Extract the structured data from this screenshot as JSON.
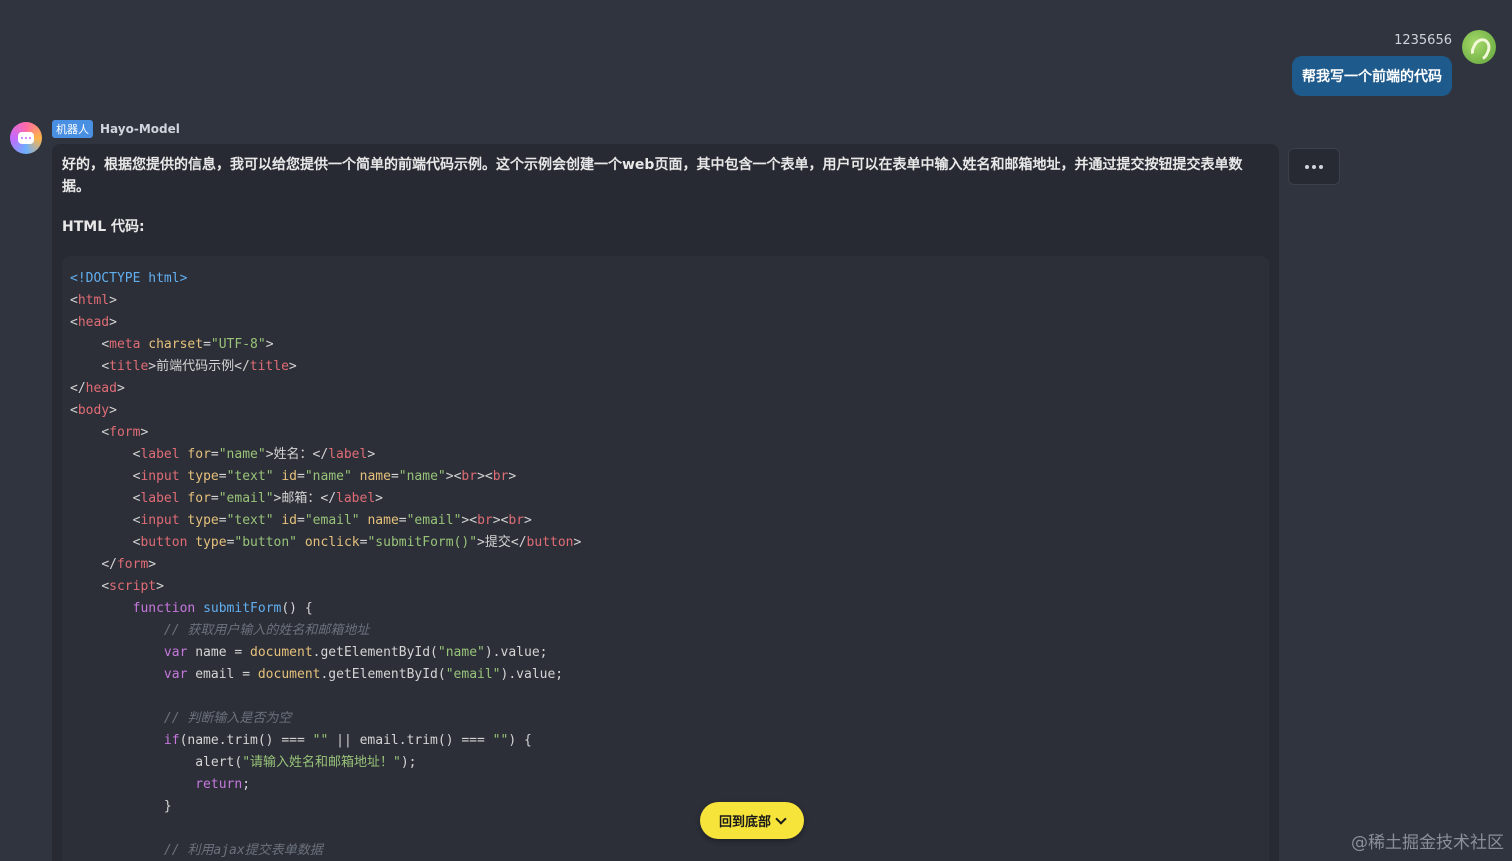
{
  "user": {
    "name": "1235656",
    "message": "帮我写一个前端的代码"
  },
  "bot": {
    "badge": "机器人",
    "name": "Hayo-Model",
    "intro": "好的，根据您提供的信息，我可以给您提供一个简单的前端代码示例。这个示例会创建一个web页面，其中包含一个表单，用户可以在表单中输入姓名和邮箱地址，并通过提交按钮提交表单数据。",
    "section_label": "HTML 代码:"
  },
  "code": {
    "doctype": "<!DOCTYPE html>",
    "title_text": "前端代码示例",
    "charset_value": "\"UTF-8\"",
    "label_name_text": "姓名：",
    "label_email_text": "邮箱：",
    "button_text": "提交",
    "comment_get": "// 获取用户输入的姓名和邮箱地址",
    "comment_check": "// 判断输入是否为空",
    "alert_text": "\"请输入姓名和邮箱地址！\"",
    "comment_submit": "// 利用ajax提交表单数据"
  },
  "actions": {
    "scroll_bottom_label": "回到底部"
  },
  "watermark": "@稀土掘金技术社区",
  "colors": {
    "background": "#30343e",
    "user_bubble": "#1e5a8c",
    "bot_message": "#272a32",
    "scroll_button": "#f7e43a",
    "badge": "#4a90e2"
  },
  "icons": {
    "more": "ellipsis-icon",
    "scroll": "chevron-down-icon"
  }
}
